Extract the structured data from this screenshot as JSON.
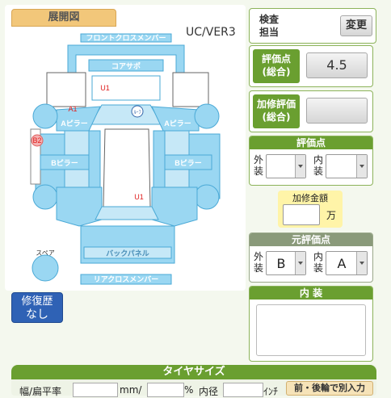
{
  "diagram": {
    "tab_label": "展開図",
    "version": "UC/VER3",
    "parts": {
      "front_cross": "フロントクロスメンバー",
      "core_support": "コアサポ",
      "a_pillar_left": "Aピラー",
      "a_pillar_right": "Aピラー",
      "b_pillar_left": "Bピラー",
      "b_pillar_right": "Bピラー",
      "back_panel": "バックパネル",
      "rear_cross": "リアクロスメンバー",
      "spare": "スペア",
      "roof_mark": "ﾙｰﾌ"
    },
    "damage_marks": [
      {
        "code": "U1"
      },
      {
        "code": "A1"
      },
      {
        "code": "B2"
      },
      {
        "code": "U1"
      }
    ]
  },
  "repair_history": {
    "line1": "修復歴",
    "line2": "なし"
  },
  "inspector": {
    "label_line1": "検査",
    "label_line2": "担当",
    "change_button": "変更"
  },
  "evaluation": {
    "label_line1": "評価点",
    "label_line2": "(総合)",
    "value": "4.5"
  },
  "additional": {
    "label_line1": "加修評価",
    "label_line2": "(総合)",
    "value": ""
  },
  "score": {
    "header": "評価点",
    "exterior_label": "外装",
    "interior_label": "内装",
    "exterior_value": "",
    "interior_value": ""
  },
  "repair_amount": {
    "label": "加修金額",
    "unit": "万",
    "value": ""
  },
  "original_score": {
    "header": "元評価点",
    "exterior_label": "外装",
    "interior_label": "内装",
    "exterior_value": "B",
    "interior_value": "A"
  },
  "interior": {
    "header": "内 装"
  },
  "tire": {
    "header": "タイヤサイズ",
    "width_label": "幅/扁平率",
    "mm_unit": "mm/",
    "pct_unit": "%",
    "inner_label": "内径",
    "inch_unit": "ｲﾝﾁ",
    "front_rear_button": "前・後輪で別入力"
  },
  "colors": {
    "accent_green": "#6a9f30",
    "diagram_blue": "#9ad7f2",
    "tab_orange": "#f2c77a",
    "button_blue": "#2f62b5"
  }
}
